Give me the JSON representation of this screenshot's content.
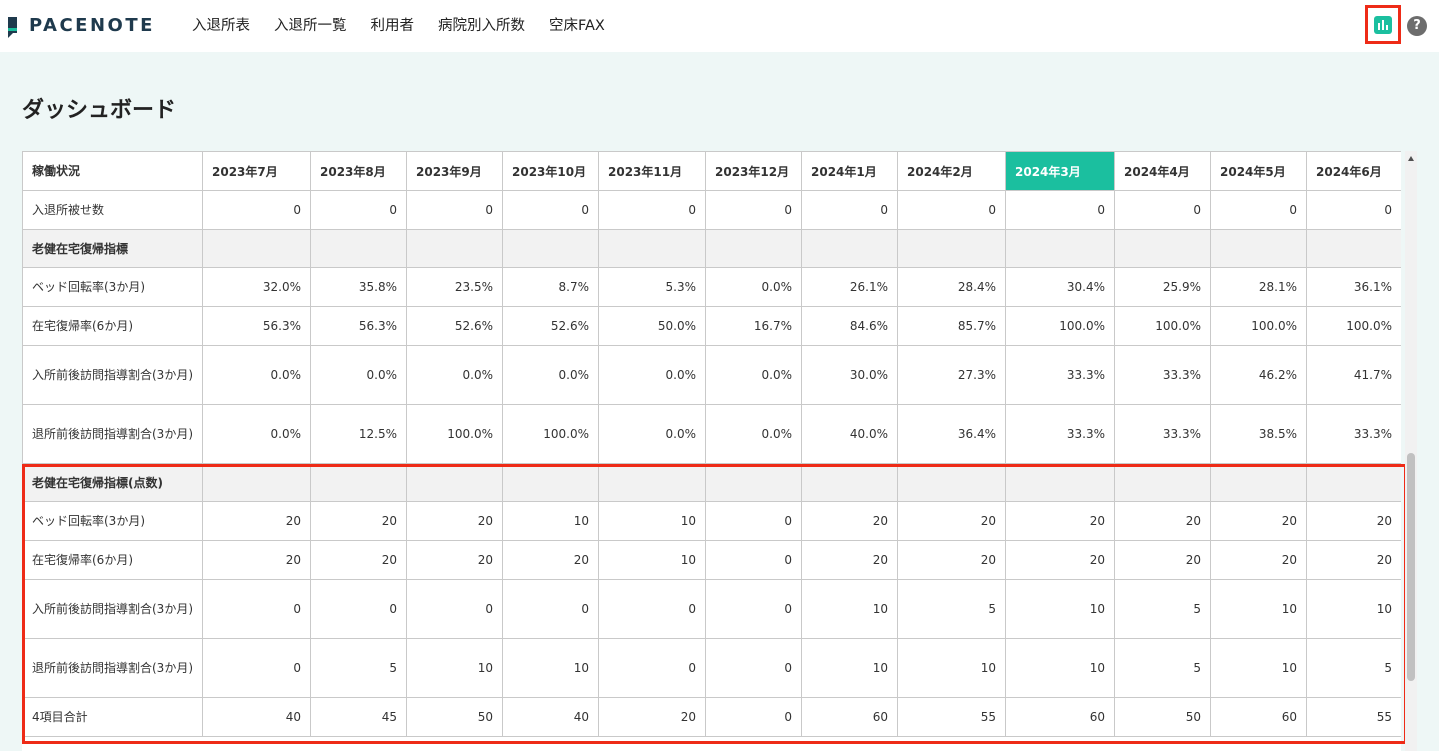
{
  "app": {
    "logo_text": "PACENOTE"
  },
  "nav": {
    "items": [
      "入退所表",
      "入退所一覧",
      "利用者",
      "病院別入所数",
      "空床FAX"
    ]
  },
  "header": {
    "chart_icon": "bar-chart-icon",
    "help_icon": "help-icon",
    "help_label": "?"
  },
  "page": {
    "title": "ダッシュボード"
  },
  "table": {
    "corner_label": "稼働状況",
    "months": [
      "2023年7月",
      "2023年8月",
      "2023年9月",
      "2023年10月",
      "2023年11月",
      "2023年12月",
      "2024年1月",
      "2024年2月",
      "2024年3月",
      "2024年4月",
      "2024年5月",
      "2024年6月"
    ],
    "active_month": "2024年3月",
    "rows": [
      {
        "type": "data",
        "label": "入退所被せ数",
        "values": [
          "0",
          "0",
          "0",
          "0",
          "0",
          "0",
          "0",
          "0",
          "0",
          "0",
          "0",
          "0"
        ]
      },
      {
        "type": "section",
        "label": "老健在宅復帰指標"
      },
      {
        "type": "data",
        "label": "ベッド回転率(3か月)",
        "values": [
          "32.0%",
          "35.8%",
          "23.5%",
          "8.7%",
          "5.3%",
          "0.0%",
          "26.1%",
          "28.4%",
          "30.4%",
          "25.9%",
          "28.1%",
          "36.1%"
        ]
      },
      {
        "type": "data",
        "label": "在宅復帰率(6か月)",
        "values": [
          "56.3%",
          "56.3%",
          "52.6%",
          "52.6%",
          "50.0%",
          "16.7%",
          "84.6%",
          "85.7%",
          "100.0%",
          "100.0%",
          "100.0%",
          "100.0%"
        ]
      },
      {
        "type": "data2",
        "label": "入所前後訪問指導割合(3か月)",
        "values": [
          "0.0%",
          "0.0%",
          "0.0%",
          "0.0%",
          "0.0%",
          "0.0%",
          "30.0%",
          "27.3%",
          "33.3%",
          "33.3%",
          "46.2%",
          "41.7%"
        ]
      },
      {
        "type": "data2",
        "label": "退所前後訪問指導割合(3か月)",
        "values": [
          "0.0%",
          "12.5%",
          "100.0%",
          "100.0%",
          "0.0%",
          "0.0%",
          "40.0%",
          "36.4%",
          "33.3%",
          "33.3%",
          "38.5%",
          "33.3%"
        ]
      },
      {
        "type": "section",
        "label": "老健在宅復帰指標(点数)"
      },
      {
        "type": "data",
        "label": "ベッド回転率(3か月)",
        "values": [
          "20",
          "20",
          "20",
          "10",
          "10",
          "0",
          "20",
          "20",
          "20",
          "20",
          "20",
          "20"
        ]
      },
      {
        "type": "data",
        "label": "在宅復帰率(6か月)",
        "values": [
          "20",
          "20",
          "20",
          "20",
          "10",
          "0",
          "20",
          "20",
          "20",
          "20",
          "20",
          "20"
        ]
      },
      {
        "type": "data2",
        "label": "入所前後訪問指導割合(3か月)",
        "values": [
          "0",
          "0",
          "0",
          "0",
          "0",
          "0",
          "10",
          "5",
          "10",
          "5",
          "10",
          "10"
        ]
      },
      {
        "type": "data2",
        "label": "退所前後訪問指導割合(3か月)",
        "values": [
          "0",
          "5",
          "10",
          "10",
          "0",
          "0",
          "10",
          "10",
          "10",
          "5",
          "10",
          "5"
        ]
      },
      {
        "type": "data",
        "label": "4項目合計",
        "values": [
          "40",
          "45",
          "50",
          "40",
          "20",
          "0",
          "60",
          "55",
          "60",
          "50",
          "60",
          "55"
        ]
      }
    ]
  },
  "colors": {
    "accent": "#1bbf9f",
    "highlight": "#ee2b17",
    "background": "#eef7f6"
  }
}
